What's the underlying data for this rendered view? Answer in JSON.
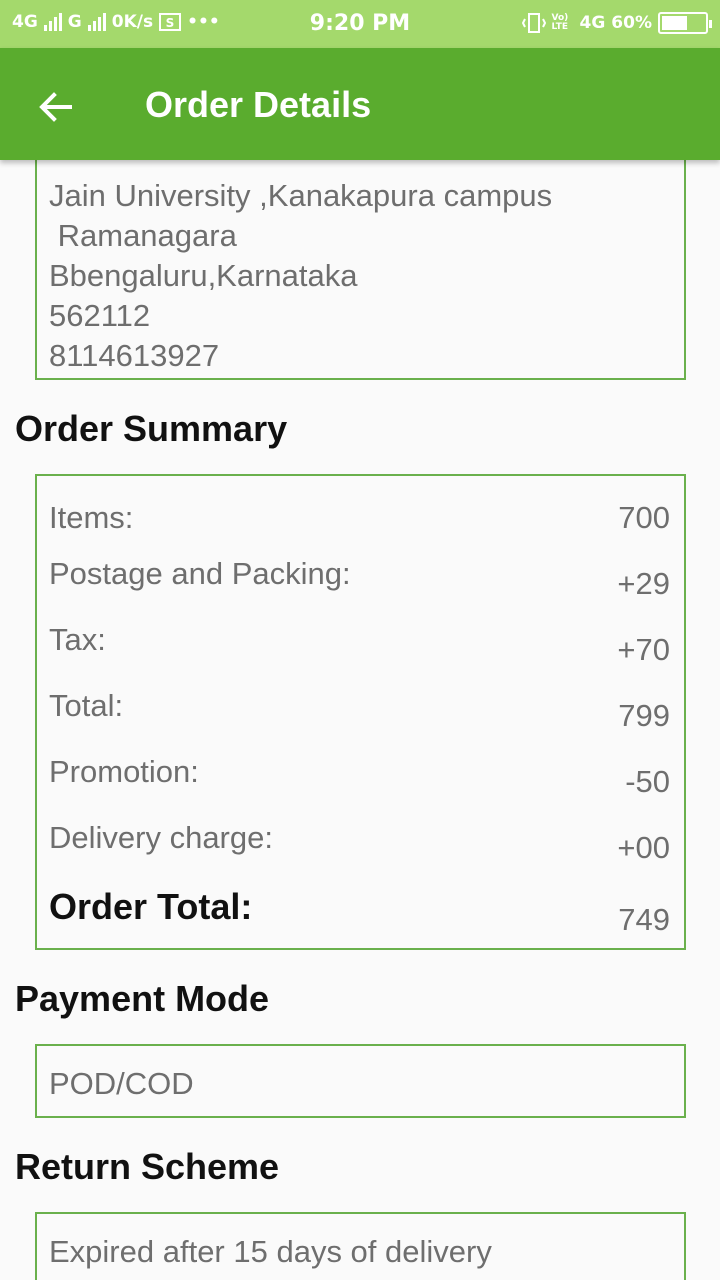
{
  "status_bar": {
    "network1": "4G",
    "network2": "G",
    "speed": "0K/s",
    "more": "•••",
    "time": "9:20 PM",
    "volte": "Vo) LTE",
    "network3": "4G",
    "battery": "60%",
    "battery_level": 0.6
  },
  "app_bar": {
    "title": "Order Details"
  },
  "address": {
    "lines": [
      "Jain University ,Kanakapura campus",
      " Ramanagara",
      "Bbengaluru,Karnataka",
      "562112",
      "8114613927"
    ]
  },
  "order_summary": {
    "title": "Order Summary",
    "rows": [
      {
        "label": "Items:",
        "value": "700"
      },
      {
        "label": "Postage and Packing:",
        "value": "+29"
      },
      {
        "label": "Tax:",
        "value": "+70"
      },
      {
        "label": "Total:",
        "value": "799"
      },
      {
        "label": "Promotion:",
        "value": "-50"
      },
      {
        "label": "Delivery charge:",
        "value": "+00"
      },
      {
        "label": "Order Total:",
        "value": "749"
      }
    ]
  },
  "payment_mode": {
    "title": "Payment Mode",
    "value": "POD/COD"
  },
  "return_scheme": {
    "title": "Return Scheme",
    "value": "Expired after 15 days of delivery"
  }
}
